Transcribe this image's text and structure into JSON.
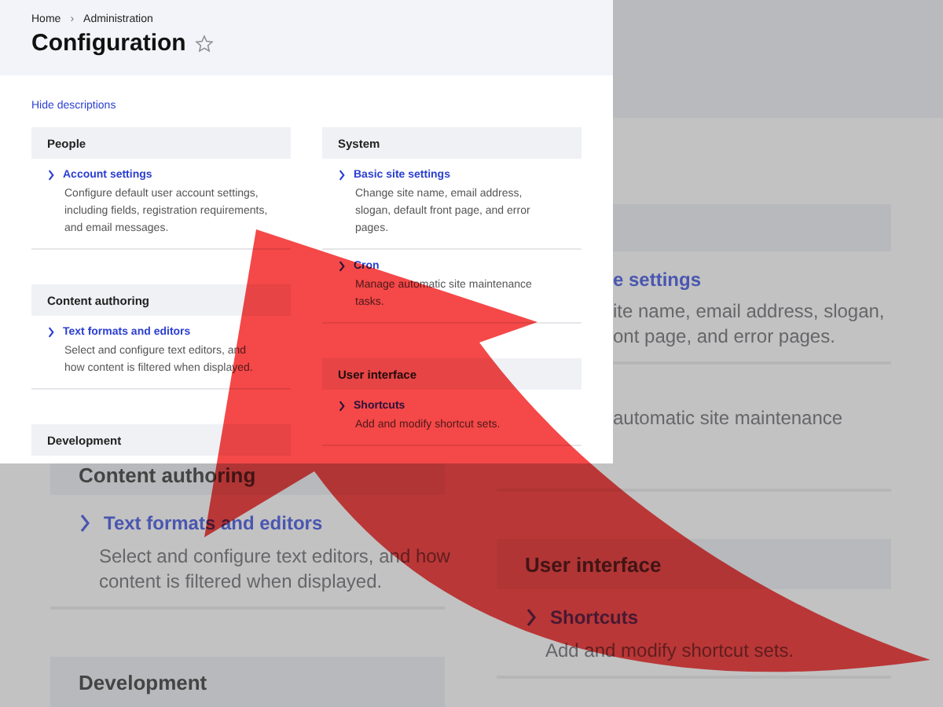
{
  "zoomed_view": {
    "upper_right": {
      "link": "e settings",
      "description": [
        "ite name, email address, slogan,",
        "ont page, and error pages."
      ],
      "second_description": "automatic site maintenance"
    },
    "left": {
      "section_title": "Content authoring",
      "link": "Text formats and editors",
      "description": [
        "Select and configure text editors, and how",
        "content is filtered when displayed."
      ],
      "next_section_title": "Development"
    },
    "right": {
      "section_title": "User interface",
      "link": "Shortcuts",
      "description": [
        "Add and modify shortcut sets."
      ]
    }
  },
  "page": {
    "breadcrumb": [
      "Home",
      "Administration"
    ],
    "breadcrumb_separator": "›",
    "title": "Configuration",
    "hide_descriptions": "Hide descriptions",
    "columns": [
      [
        {
          "title": "People",
          "items": [
            {
              "label": "Account settings",
              "description": "Configure default user account settings, including fields, registration requirements, and email messages."
            }
          ]
        },
        {
          "title": "Content authoring",
          "items": [
            {
              "label": "Text formats and editors",
              "description": "Select and configure text editors, and how content is filtered when displayed."
            }
          ]
        },
        {
          "title": "Development"
        }
      ],
      [
        {
          "title": "System",
          "items": [
            {
              "label": "Basic site settings",
              "description": "Change site name, email address, slogan, default front page, and error pages."
            },
            {
              "label": "Cron",
              "description": "Manage automatic site maintenance tasks."
            }
          ]
        },
        {
          "title": "User interface",
          "items": [
            {
              "label": "Shortcuts",
              "description": "Add and modify shortcut sets."
            }
          ]
        }
      ]
    ]
  }
}
